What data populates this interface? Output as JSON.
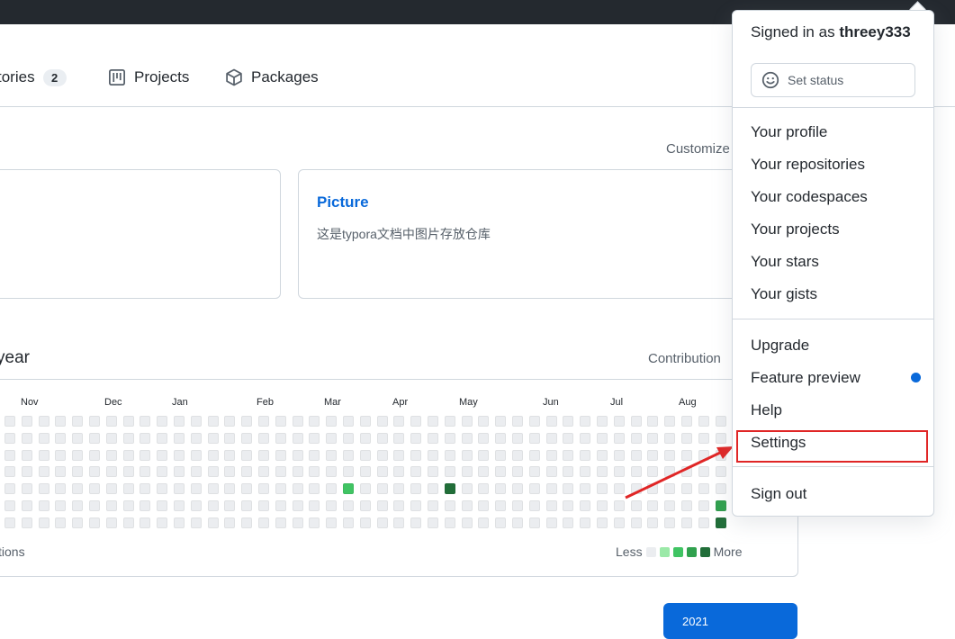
{
  "nav": {
    "tabs": [
      {
        "label": "tories",
        "count": "2",
        "icon": "repo-icon"
      },
      {
        "label": "Projects",
        "icon": "project-icon"
      },
      {
        "label": "Packages",
        "icon": "package-icon"
      }
    ]
  },
  "pinned": {
    "customize_label": "Customize",
    "repo": {
      "name": "Picture",
      "description": "这是typora文档中图片存放仓库"
    }
  },
  "contributions": {
    "heading": "year",
    "settings_label": "Contribution",
    "months": [
      "Nov",
      "Dec",
      "Jan",
      "Feb",
      "Mar",
      "Apr",
      "May",
      "Jun",
      "Jul",
      "Aug"
    ],
    "footer_link": "tions",
    "legend_less": "Less",
    "legend_more": "More",
    "levels": [
      "#ebedf0",
      "#9be9a8",
      "#40c463",
      "#30a14e",
      "#216e39"
    ],
    "active_days": [
      {
        "week": 20,
        "day": 4,
        "level": 2
      },
      {
        "week": 26,
        "day": 4,
        "level": 4
      },
      {
        "week": 42,
        "day": 5,
        "level": 3
      },
      {
        "week": 42,
        "day": 6,
        "level": 4
      }
    ]
  },
  "year_selector": {
    "selected": "2021"
  },
  "user_menu": {
    "signed_in_prefix": "Signed in as",
    "username": "threey333",
    "set_status": "Set status",
    "group1": [
      "Your profile",
      "Your repositories",
      "Your codespaces",
      "Your projects",
      "Your stars",
      "Your gists"
    ],
    "upgrade": "Upgrade",
    "feature_preview": "Feature preview",
    "help": "Help",
    "settings": "Settings",
    "sign_out": "Sign out"
  },
  "colors": {
    "accent": "#0969da",
    "highlight_box": "#e02626",
    "annotation_arrow": "#e02626"
  }
}
